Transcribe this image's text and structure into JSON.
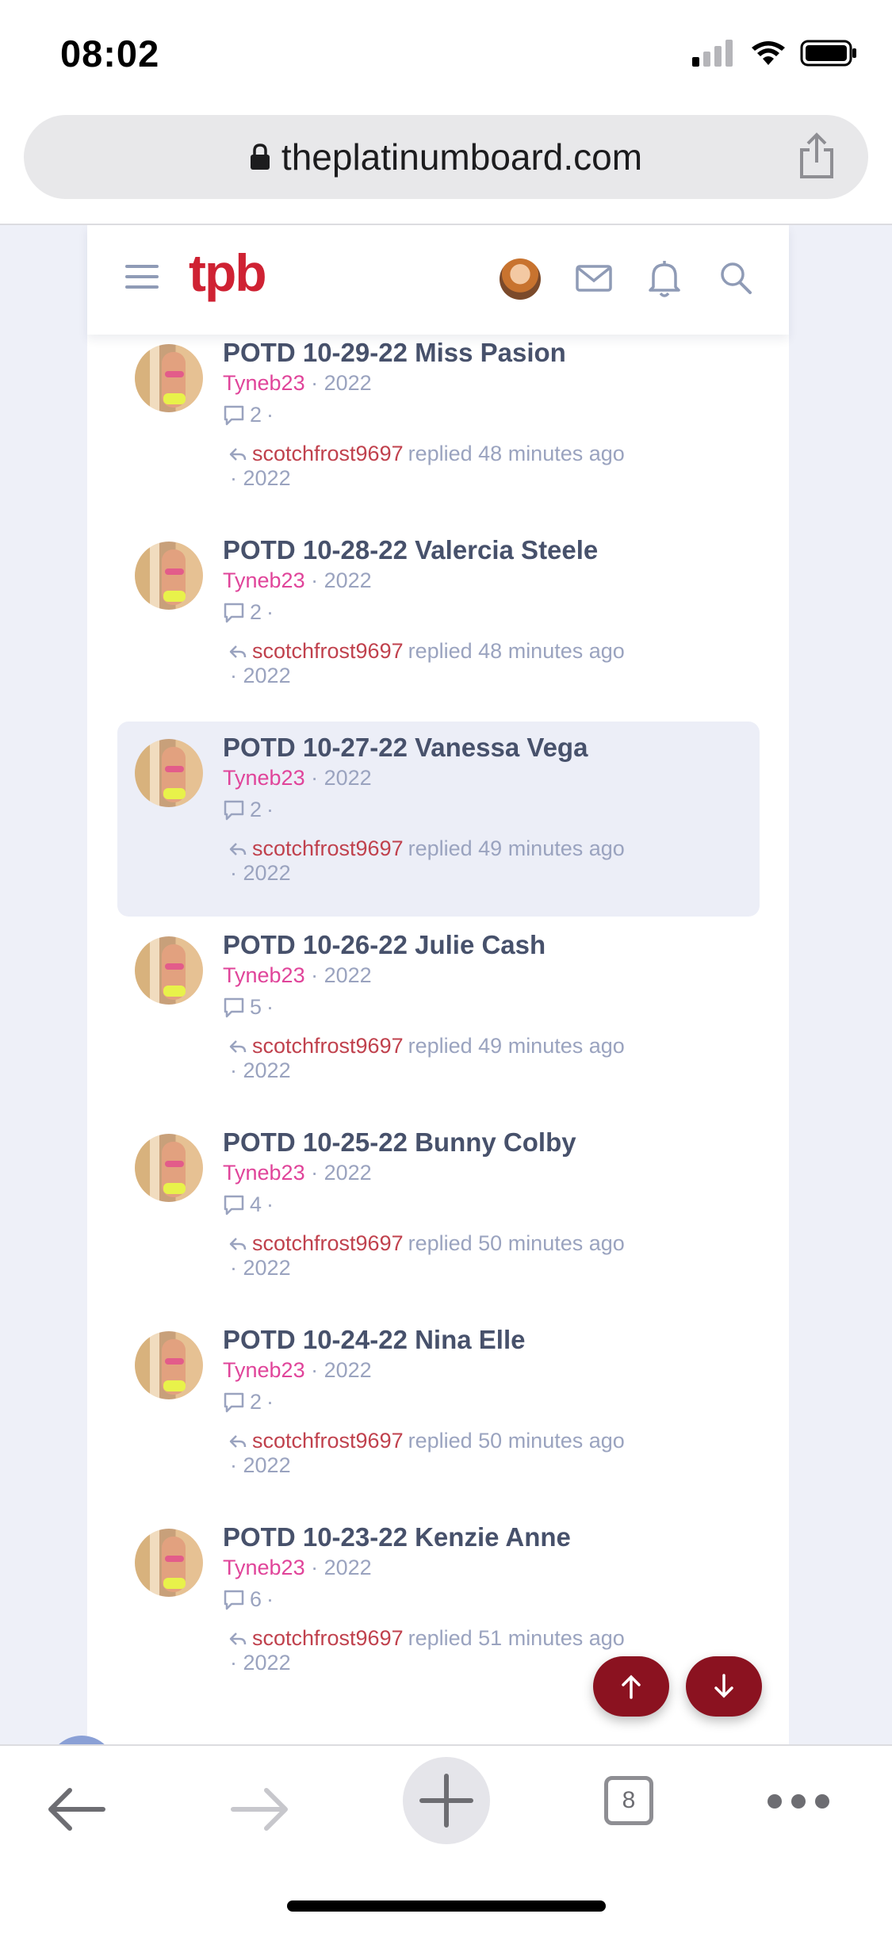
{
  "status_bar": {
    "time": "08:02"
  },
  "browser": {
    "url": "theplatinumboard.com",
    "tab_count": "8"
  },
  "forum": {
    "logo": "tpb"
  },
  "threads": [
    {
      "title": "POTD 10-29-22 Miss Pasion",
      "author": "Tyneb23",
      "date": "2022",
      "replies": "2",
      "last_user": "scotchfrost9697",
      "last_action": "replied 48 minutes ago",
      "last_date": "2022",
      "highlighted": false
    },
    {
      "title": "POTD 10-28-22 Valercia Steele",
      "author": "Tyneb23",
      "date": "2022",
      "replies": "2",
      "last_user": "scotchfrost9697",
      "last_action": "replied 48 minutes ago",
      "last_date": "2022",
      "highlighted": false
    },
    {
      "title": "POTD 10-27-22 Vanessa Vega",
      "author": "Tyneb23",
      "date": "2022",
      "replies": "2",
      "last_user": "scotchfrost9697",
      "last_action": "replied 49 minutes ago",
      "last_date": "2022",
      "highlighted": true
    },
    {
      "title": "POTD 10-26-22 Julie Cash",
      "author": "Tyneb23",
      "date": "2022",
      "replies": "5",
      "last_user": "scotchfrost9697",
      "last_action": "replied 49 minutes ago",
      "last_date": "2022",
      "highlighted": false
    },
    {
      "title": "POTD 10-25-22 Bunny Colby",
      "author": "Tyneb23",
      "date": "2022",
      "replies": "4",
      "last_user": "scotchfrost9697",
      "last_action": "replied 50 minutes ago",
      "last_date": "2022",
      "highlighted": false
    },
    {
      "title": "POTD 10-24-22 Nina Elle",
      "author": "Tyneb23",
      "date": "2022",
      "replies": "2",
      "last_user": "scotchfrost9697",
      "last_action": "replied 50 minutes ago",
      "last_date": "2022",
      "highlighted": false
    },
    {
      "title": "POTD 10-23-22 Kenzie Anne",
      "author": "Tyneb23",
      "date": "2022",
      "replies": "6",
      "last_user": "scotchfrost9697",
      "last_action": "replied 51 minutes ago",
      "last_date": "2022",
      "highlighted": false
    }
  ],
  "separator": "·",
  "icons": {
    "lock": "lock-icon",
    "share": "share-icon",
    "menu": "hamburger-menu-icon",
    "mail": "mail-icon",
    "bell": "bell-icon",
    "search": "search-icon",
    "reply": "reply-arrow-icon",
    "comment": "comment-icon",
    "back": "back-arrow-icon",
    "forward": "forward-arrow-icon",
    "new_tab": "plus-icon",
    "more": "more-dots-icon",
    "scroll_up": "arrow-up-icon",
    "scroll_down": "arrow-down-icon"
  },
  "colors": {
    "brand": "#cf2233",
    "author": "#e0449a",
    "last_user": "#c0414d",
    "fab": "#8b1220",
    "highlight": "#eceef7"
  }
}
